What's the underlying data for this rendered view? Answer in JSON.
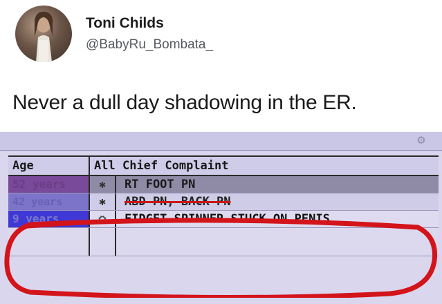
{
  "tweet": {
    "author_name": "Toni Childs",
    "handle": "@BabyRu_Bombata_",
    "text": "Never a dull day shadowing in the ER.",
    "avatar_icon": "profile-photo"
  },
  "er_board": {
    "header": {
      "age": "Age",
      "all": "All",
      "complaint": "Chief Complaint"
    },
    "rows": [
      {
        "age": "52 years",
        "icon": "dot-icon",
        "complaint": "RT FOOT PN"
      },
      {
        "age": "42 years",
        "icon": "dot-icon",
        "complaint": "ABD PN, BACK PN"
      },
      {
        "age": "9 years",
        "icon": "bike-icon",
        "complaint": "FIDGET SPINNER STUCK ON PENIS"
      }
    ],
    "annotation_color": "#d3141a",
    "highlight_colors": [
      "#7a4a9a",
      "#7c74c8",
      "#3f38d6"
    ]
  }
}
